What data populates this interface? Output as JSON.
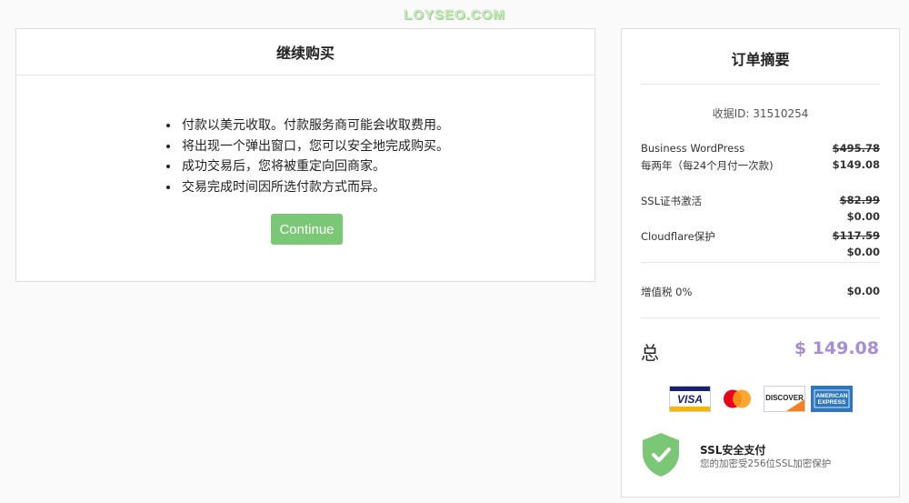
{
  "watermark": "LOYSEO.COM",
  "checkout": {
    "title": "继续购买",
    "notes": [
      "付款以美元收取。付款服务商可能会收取费用。",
      "将出现一个弹出窗口，您可以安全地完成购买。",
      "成功交易后，您将被重定向回商家。",
      "交易完成时间因所选付款方式而异。"
    ],
    "continue_label": "Continue",
    "continue_color": "#7ac875"
  },
  "summary": {
    "title": "订单摘要",
    "invoice_id": "收据ID: 31510254",
    "items": [
      {
        "name": "Business WordPress",
        "original": "$495.78",
        "term": "每两年（每24个月付一次款)",
        "price": "$149.08"
      },
      {
        "name": "SSL证书激活",
        "original": "$82.99",
        "price": "$0.00"
      },
      {
        "name": "Cloudflare保护",
        "original": "$117.59",
        "price": "$0.00"
      }
    ],
    "tax": {
      "label": "增值税 0%",
      "value": "$0.00"
    },
    "total": {
      "label": "总",
      "value": "$ 149.08",
      "color": "#a68ed6"
    },
    "payment_icons": [
      "visa-card-icon",
      "mastercard-icon",
      "discover-card-icon",
      "american-express-icon"
    ],
    "ssl": {
      "title": "SSL安全支付",
      "description": "您的加密受256位SSL加密保护",
      "shield_color": "#7ac875"
    }
  }
}
